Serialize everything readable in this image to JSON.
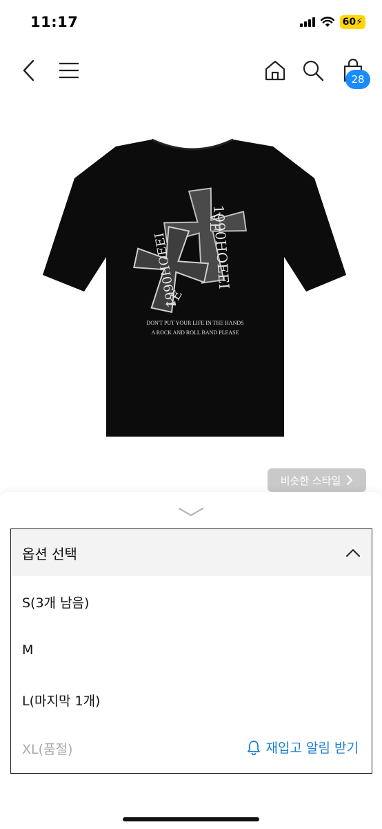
{
  "status_bar": {
    "time": "11:17",
    "battery": "60",
    "battery_charging_symbol": "⚡"
  },
  "nav": {
    "back_icon": "chevron-left-icon",
    "menu_icon": "hamburger-icon",
    "home_icon": "home-icon",
    "search_icon": "search-icon",
    "cart_icon": "shopping-bag-icon",
    "cart_count": "28"
  },
  "product": {
    "print_line1": "DON'T PUT YOUR LIFE IN THE HANDS",
    "print_line2": "A ROCK AND ROLL BAND PLEASE",
    "graphic_text": "1990HOEEI",
    "graphic_letters": "VE"
  },
  "similar_style": {
    "label": "비슷한 스타일"
  },
  "options": {
    "header": "옵션 선택",
    "items": [
      {
        "label": "S(3개 남음)"
      },
      {
        "label": "M"
      },
      {
        "label": "L(마지막 1개)"
      },
      {
        "label": "XL(품절)"
      }
    ],
    "restock_label": "재입고 알림 받기"
  },
  "colors": {
    "accent": "#1a8cff",
    "restock": "#1a7fd4",
    "battery": "#ffd60a"
  }
}
